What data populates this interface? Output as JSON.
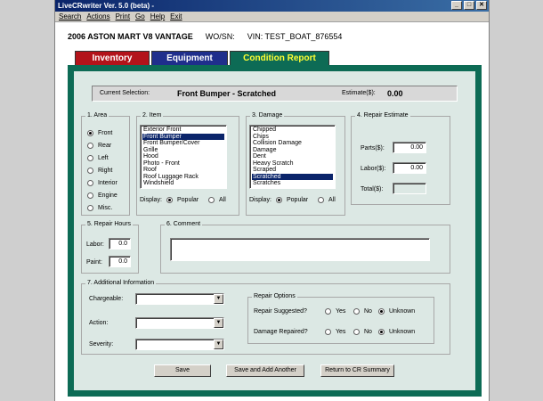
{
  "window": {
    "title": "LiveCRwriter Ver. 5.0 (beta) -",
    "controls": [
      "_",
      "□",
      "✕"
    ]
  },
  "menu": [
    "Search",
    "Actions",
    "Print",
    "Go",
    "Help",
    "Exit"
  ],
  "header": {
    "vehicle": "2006   ASTON MART V8 VANTAGE",
    "wo_label": "WO/SN:",
    "vin": "VIN: TEST_BOAT_876554"
  },
  "tabs": [
    {
      "label": "Inventory",
      "active": false
    },
    {
      "label": "Equipment",
      "active": false
    },
    {
      "label": "Condition Report",
      "active": true
    }
  ],
  "selection": {
    "label": "Current Selection:",
    "value": "Front Bumper - Scratched",
    "estimate_label": "Estimate($):",
    "estimate_value": "0.00"
  },
  "area": {
    "title": "1. Area",
    "options": [
      "Front",
      "Rear",
      "Left",
      "Right",
      "Interior",
      "Engine",
      "Misc."
    ],
    "selected": "Front"
  },
  "item": {
    "title": "2. Item",
    "options": [
      "Exterior Front",
      "Front Bumper",
      "Front Bumper/Cover",
      "Grille",
      "Hood",
      "Photo - Front",
      "Roof",
      "Roof Luggage Rack",
      "Windshield"
    ],
    "selected": "Front Bumper",
    "display_label": "Display:",
    "display_popular": "Popular",
    "display_all": "All"
  },
  "damage": {
    "title": "3. Damage",
    "options": [
      "Chipped",
      "Chips",
      "Collision Damage",
      "Damage",
      "Dent",
      "Heavy Scratch",
      "Scraped",
      "Scratched",
      "Scratches"
    ],
    "selected": "Scratched",
    "display_label": "Display:",
    "display_popular": "Popular",
    "display_all": "All"
  },
  "estimate": {
    "title": "4. Repair Estimate",
    "parts_label": "Parts($):",
    "parts_value": "0.00",
    "labor_label": "Labor($):",
    "labor_value": "0.00",
    "total_label": "Total($):",
    "total_value": ""
  },
  "hours": {
    "title": "5. Repair Hours",
    "labor_label": "Labor:",
    "labor_value": "0.0",
    "paint_label": "Paint:",
    "paint_value": "0.0"
  },
  "comment": {
    "title": "6. Comment",
    "value": ""
  },
  "additional": {
    "title": "7. Additional Information",
    "chargeable_label": "Chargeable:",
    "action_label": "Action:",
    "severity_label": "Severity:",
    "chargeable_value": "",
    "action_value": "",
    "severity_value": ""
  },
  "repair_options": {
    "title": "Repair Options",
    "suggested_label": "Repair Suggested?",
    "repaired_label": "Damage Repaired?",
    "yes": "Yes",
    "no": "No",
    "unknown": "Unknown",
    "suggested_value": "Unknown",
    "repaired_value": "Unknown"
  },
  "buttons": {
    "save": "Save",
    "save_add": "Save and Add Another",
    "return": "Return to CR Summary"
  },
  "colors": {
    "inventory_tab": "#b3131a",
    "equipment_tab": "#1f2e8c",
    "condition_tab": "#0d6b55",
    "panel_bg": "#dce8e4",
    "selection_highlight": "#0a246a"
  }
}
